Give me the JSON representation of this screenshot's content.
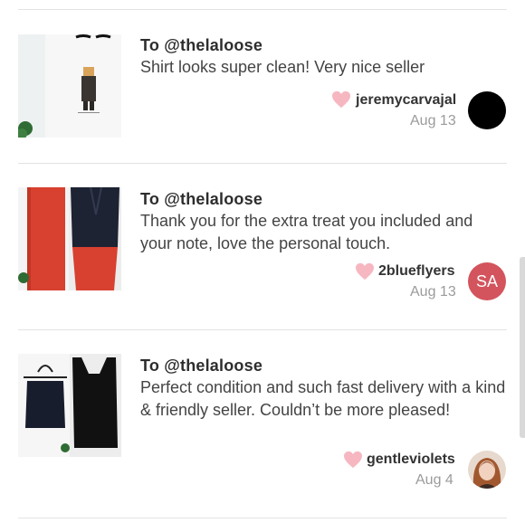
{
  "reviews": [
    {
      "to": "To @thelaloose",
      "message": "Shirt looks super clean! Very nice seller",
      "username": "jeremycarvajal",
      "date": "Aug 13",
      "avatar_initials": ""
    },
    {
      "to": "To @thelaloose",
      "message": "Thank you for the extra treat you included and your note, love the personal touch.",
      "username": "2blueflyers",
      "date": "Aug 13",
      "avatar_initials": "SA"
    },
    {
      "to": "To @thelaloose",
      "message": "Perfect condition and such fast delivery with a kind & friendly seller. Couldn’t be more pleased!",
      "username": "gentleviolets",
      "date": "Aug 4",
      "avatar_initials": ""
    }
  ],
  "icons": {
    "heart": "heart-icon",
    "heart_color": "#f6b7c1"
  },
  "colors": {
    "avatar_sa": "#d3545d",
    "avatar_black": "#000000"
  }
}
